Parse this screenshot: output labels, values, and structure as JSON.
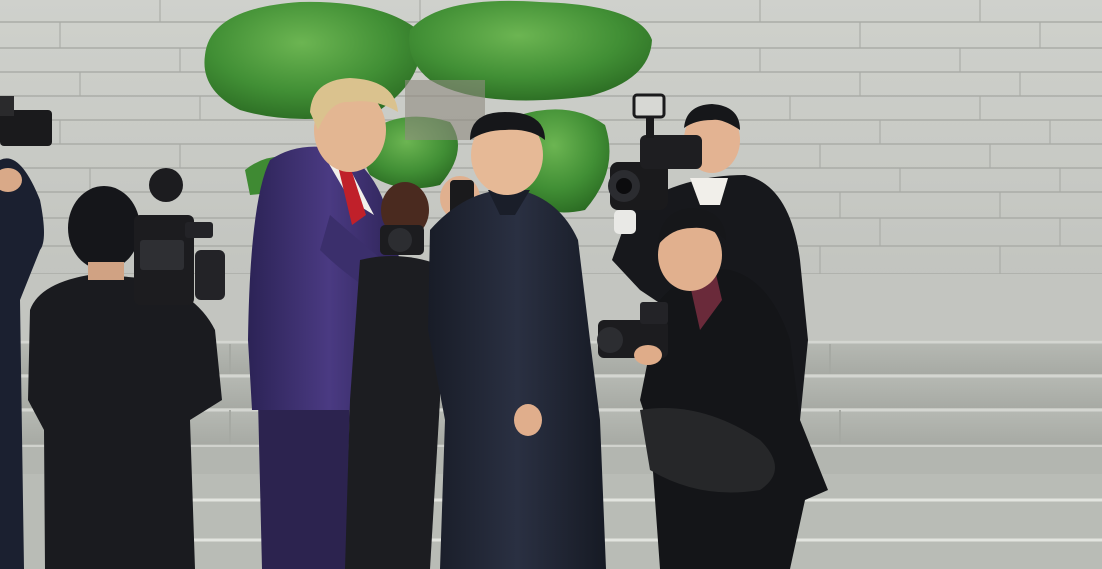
{
  "scene": {
    "description_tag": "photo-frame",
    "colors": {
      "stone_light": "#c9cbc6",
      "stone_mid": "#b4b6b1",
      "stone_dark": "#9ea09b",
      "shrub": "#3f8a33",
      "shrub_light": "#5ea84a",
      "suit_purple": "#3a2d6a",
      "suit_dark": "#1e2330",
      "suit_black": "#141518",
      "skin": "#e2b594",
      "hair_blond": "#d8c08c",
      "hair_dark": "#16171a",
      "tie_red": "#c0202a",
      "camera": "#1a1a1c"
    }
  }
}
